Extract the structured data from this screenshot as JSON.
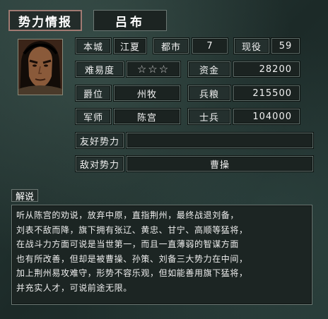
{
  "header": {
    "title": "势力情报",
    "ruler_name": "吕布"
  },
  "stats": {
    "home_city_label": "本城",
    "home_city": "江夏",
    "cities_label": "都市",
    "cities": "7",
    "officers_label": "现役",
    "officers": "59",
    "difficulty_label": "难易度",
    "difficulty": "☆☆☆",
    "funds_label": "资金",
    "funds": "28200",
    "rank_label": "爵位",
    "rank": "州牧",
    "food_label": "兵粮",
    "food": "215500",
    "strategist_label": "军师",
    "strategist": "陈宫",
    "soldiers_label": "士兵",
    "soldiers": "104000"
  },
  "relations": {
    "friendly_label": "友好势力",
    "friendly": "",
    "hostile_label": "敌对势力",
    "hostile": "曹操"
  },
  "explanation": {
    "label": "解说",
    "lines": [
      "听从陈宫的劝说，放弃中原，直指荆州，最终战退刘备，",
      "刘表不敌而降，旗下拥有张辽、黄忠、甘宁、高顺等猛将，",
      "在战斗力方面可说是当世第一，而且一直薄弱的智谋方面",
      "也有所改善，但却是被曹操、孙策、刘备三大势力在中间，",
      "加上荆州易攻难守，形势不容乐观，但如能善用旗下猛将，",
      "并充实人才，可说前途无限。"
    ]
  },
  "colors": {
    "title_border": "#a07a72",
    "panel": "#1c2523"
  }
}
